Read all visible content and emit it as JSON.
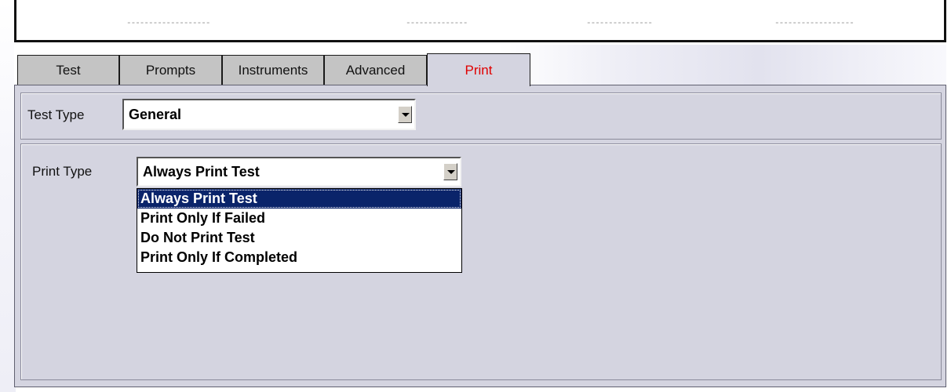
{
  "header": {
    "placeholders": [
      "-------------------",
      "--------------",
      "---------------",
      "------------------"
    ]
  },
  "tabs": [
    {
      "label": "Test",
      "active": false
    },
    {
      "label": "Prompts",
      "active": false
    },
    {
      "label": "Instruments",
      "active": false
    },
    {
      "label": "Advanced",
      "active": false
    },
    {
      "label": "Print",
      "active": true
    }
  ],
  "test_type": {
    "label": "Test Type",
    "value": "General",
    "icon": "chevron-down-icon"
  },
  "print_type": {
    "label": "Print Type",
    "value": "Always Print Test",
    "icon": "chevron-down-icon",
    "options": [
      {
        "label": "Always Print Test",
        "selected": true
      },
      {
        "label": "Print Only If Failed",
        "selected": false
      },
      {
        "label": "Do Not Print Test",
        "selected": false
      },
      {
        "label": "Print Only If Completed",
        "selected": false
      }
    ]
  },
  "colors": {
    "active_tab_text": "#e00000",
    "selection": "#0a246a",
    "panel": "#d4d4e0",
    "tab": "#c4c4c4"
  }
}
